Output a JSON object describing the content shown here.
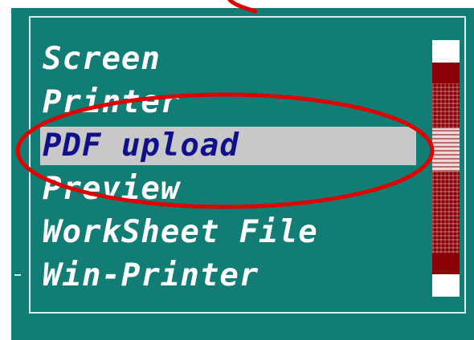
{
  "menu": {
    "items": [
      {
        "label": "Screen"
      },
      {
        "label": "Printer"
      },
      {
        "label": "PDF upload",
        "selected": true
      },
      {
        "label": "Preview"
      },
      {
        "label": "WorkSheet File"
      },
      {
        "label": "Win-Printer"
      }
    ]
  },
  "colors": {
    "panel_background": "#127d75",
    "frame_line": "#d9eeee",
    "menu_text": "#ffffff",
    "selected_background": "#c8c8c8",
    "selected_text": "#10108a",
    "scrollbar": "#8b0006",
    "annotation": "#e00000"
  },
  "scrollbar": {
    "thumb_position_fraction": 0.45
  }
}
